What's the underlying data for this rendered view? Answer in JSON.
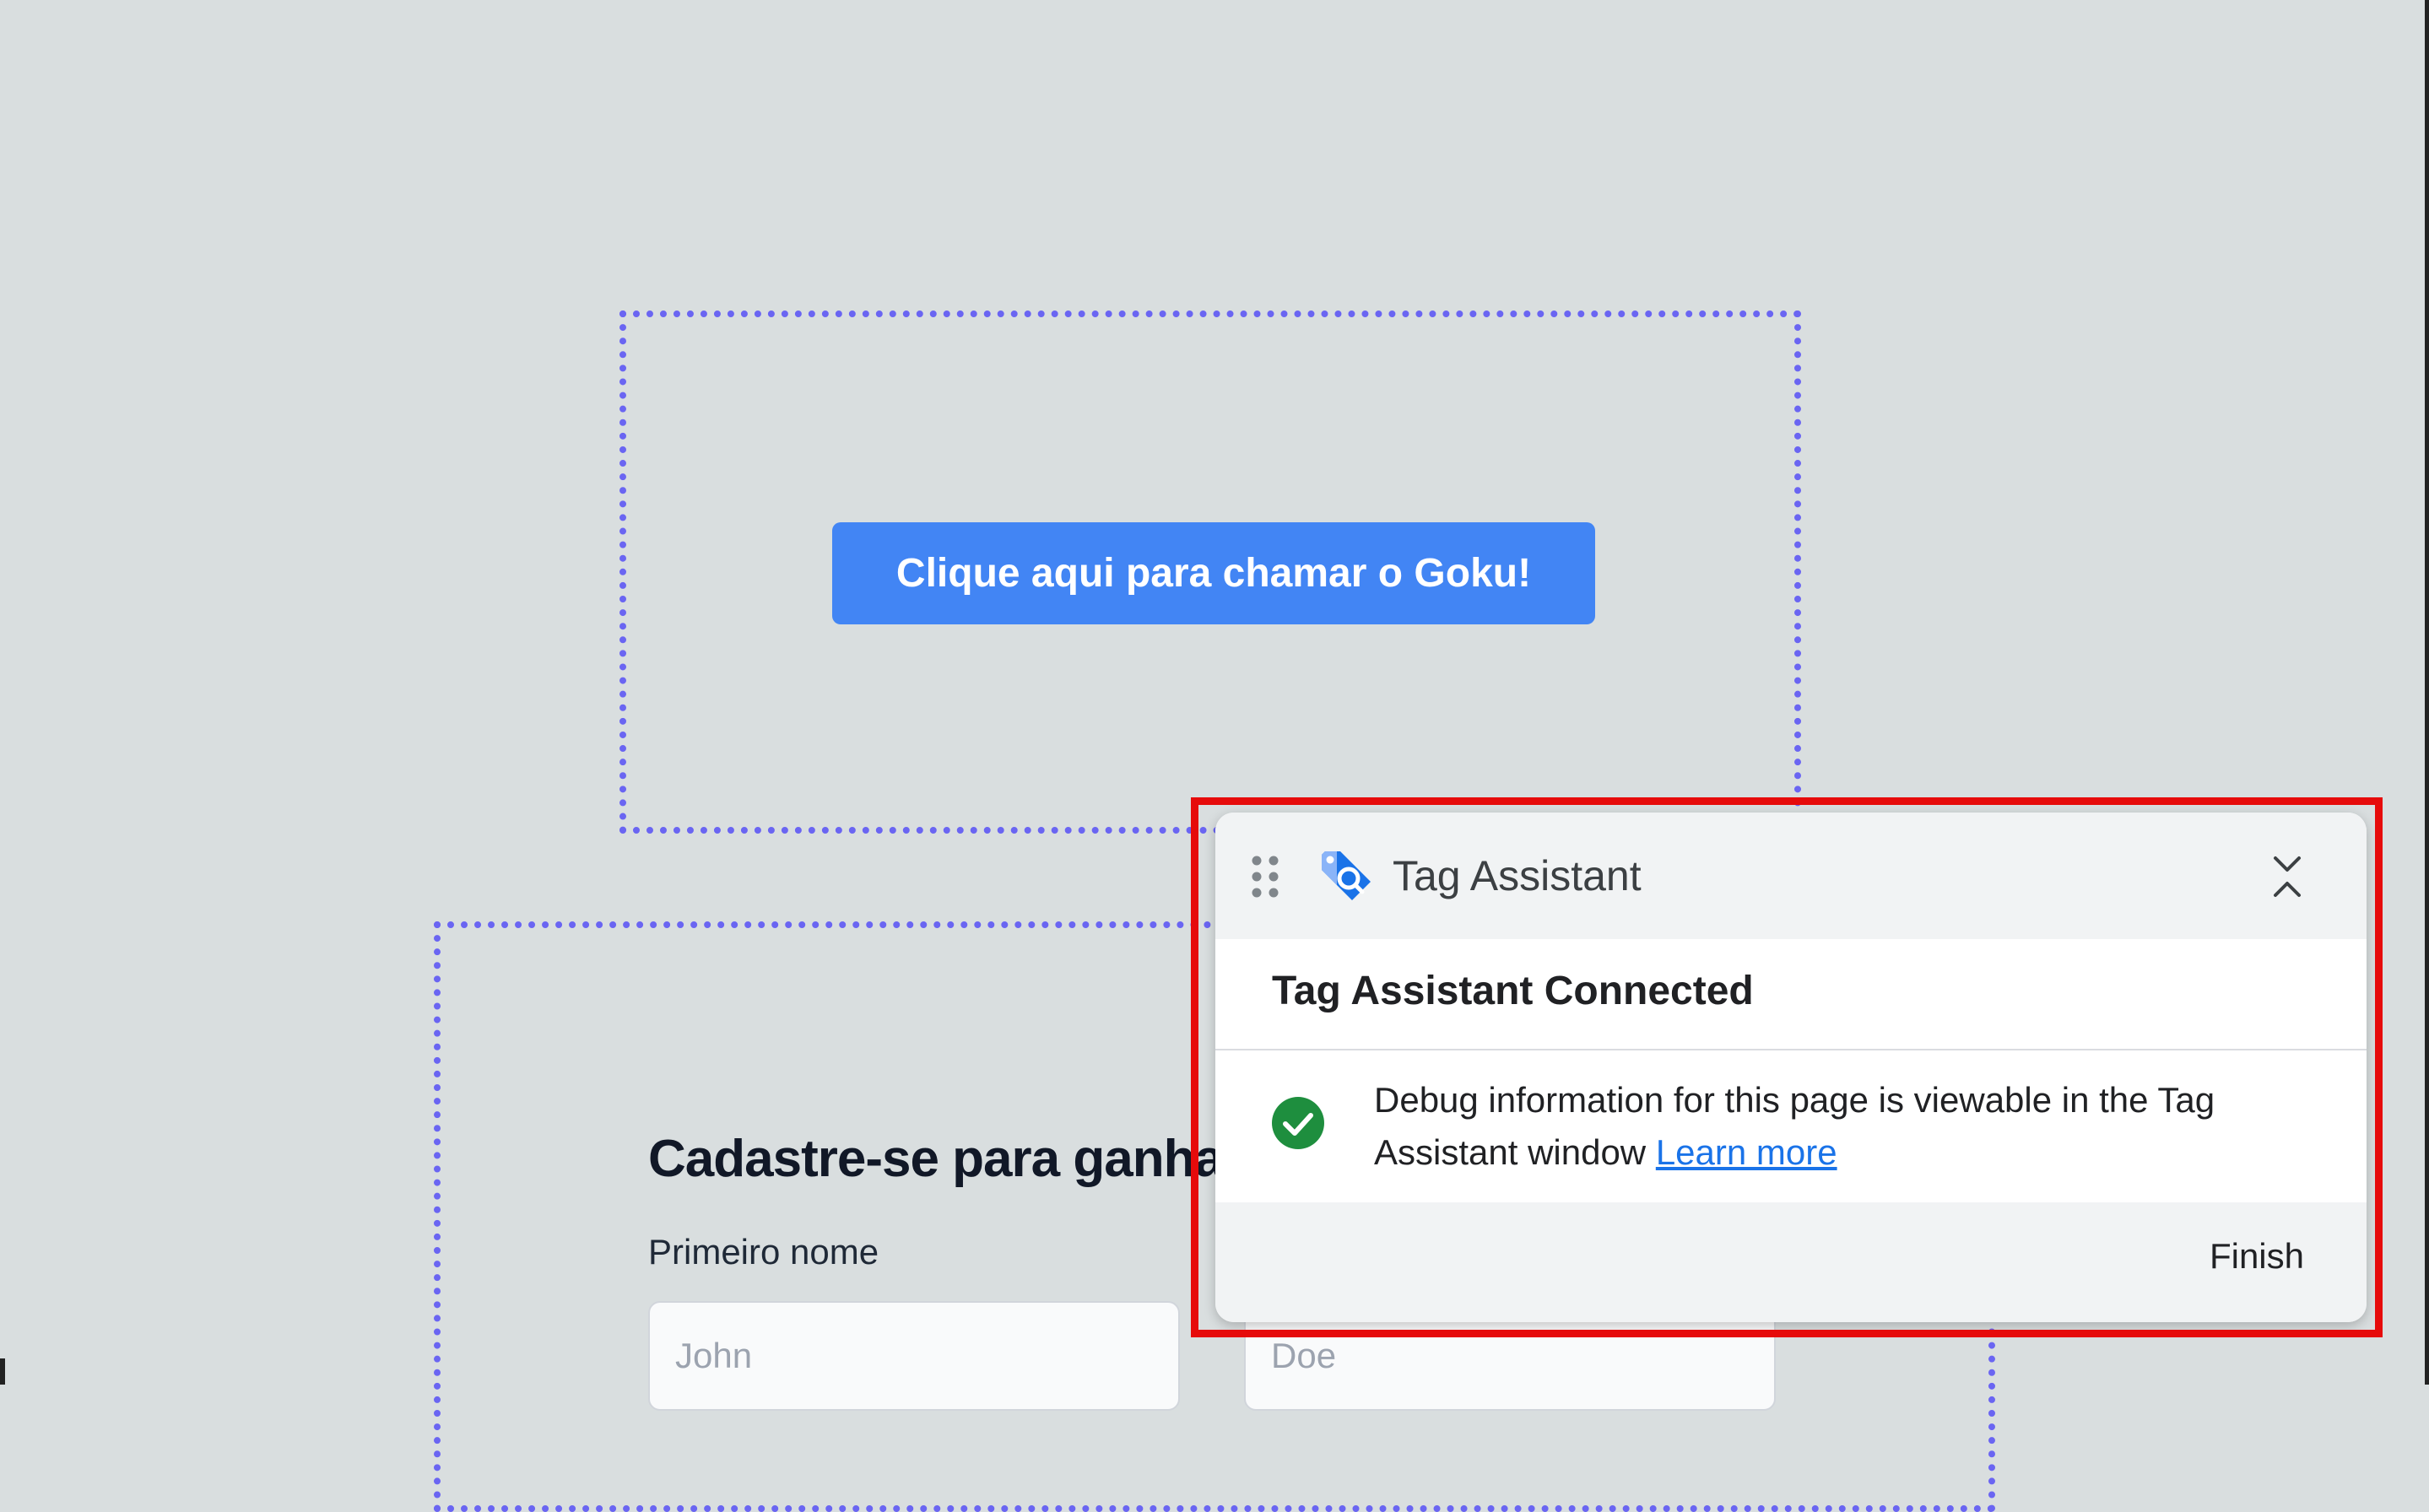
{
  "page": {
    "cta_button_label": "Clique aqui para chamar o Goku!",
    "signup_heading": "Cadastre-se para ganha",
    "first_name_label": "Primeiro nome",
    "first_name_placeholder": "John",
    "last_name_placeholder": "Doe"
  },
  "tag_assistant": {
    "title": "Tag Assistant",
    "status_heading": "Tag Assistant Connected",
    "message": "Debug information for this page is viewable in the Tag Assistant window",
    "learn_more_label": "Learn more",
    "finish_label": "Finish",
    "icons": {
      "drag": "drag-handle-icon",
      "logo": "tag-assistant-logo-icon",
      "collapse": "collapse-icon",
      "status": "check-circle-icon"
    }
  },
  "colors": {
    "background": "#d9dedf",
    "cta_blue": "#4285f4",
    "dotted_outline": "#6a65f2",
    "highlight_red": "#e60b0b",
    "success_green": "#1e8e3e",
    "link_blue": "#1a73e8"
  }
}
